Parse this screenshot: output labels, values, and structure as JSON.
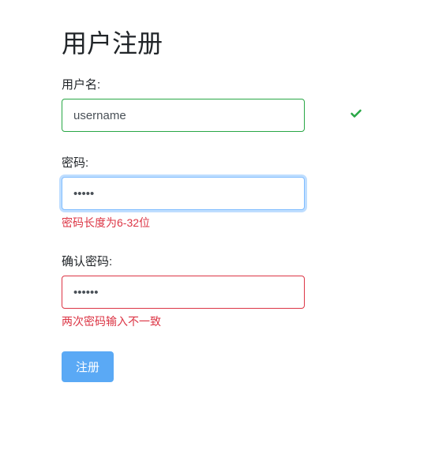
{
  "form": {
    "title": "用户注册",
    "fields": {
      "username": {
        "label": "用户名:",
        "value": "username"
      },
      "password": {
        "label": "密码:",
        "value": "•••••",
        "error": "密码长度为6-32位"
      },
      "confirm_password": {
        "label": "确认密码:",
        "value": "••••••",
        "error": "两次密码输入不一致"
      }
    },
    "submit_label": "注册"
  }
}
